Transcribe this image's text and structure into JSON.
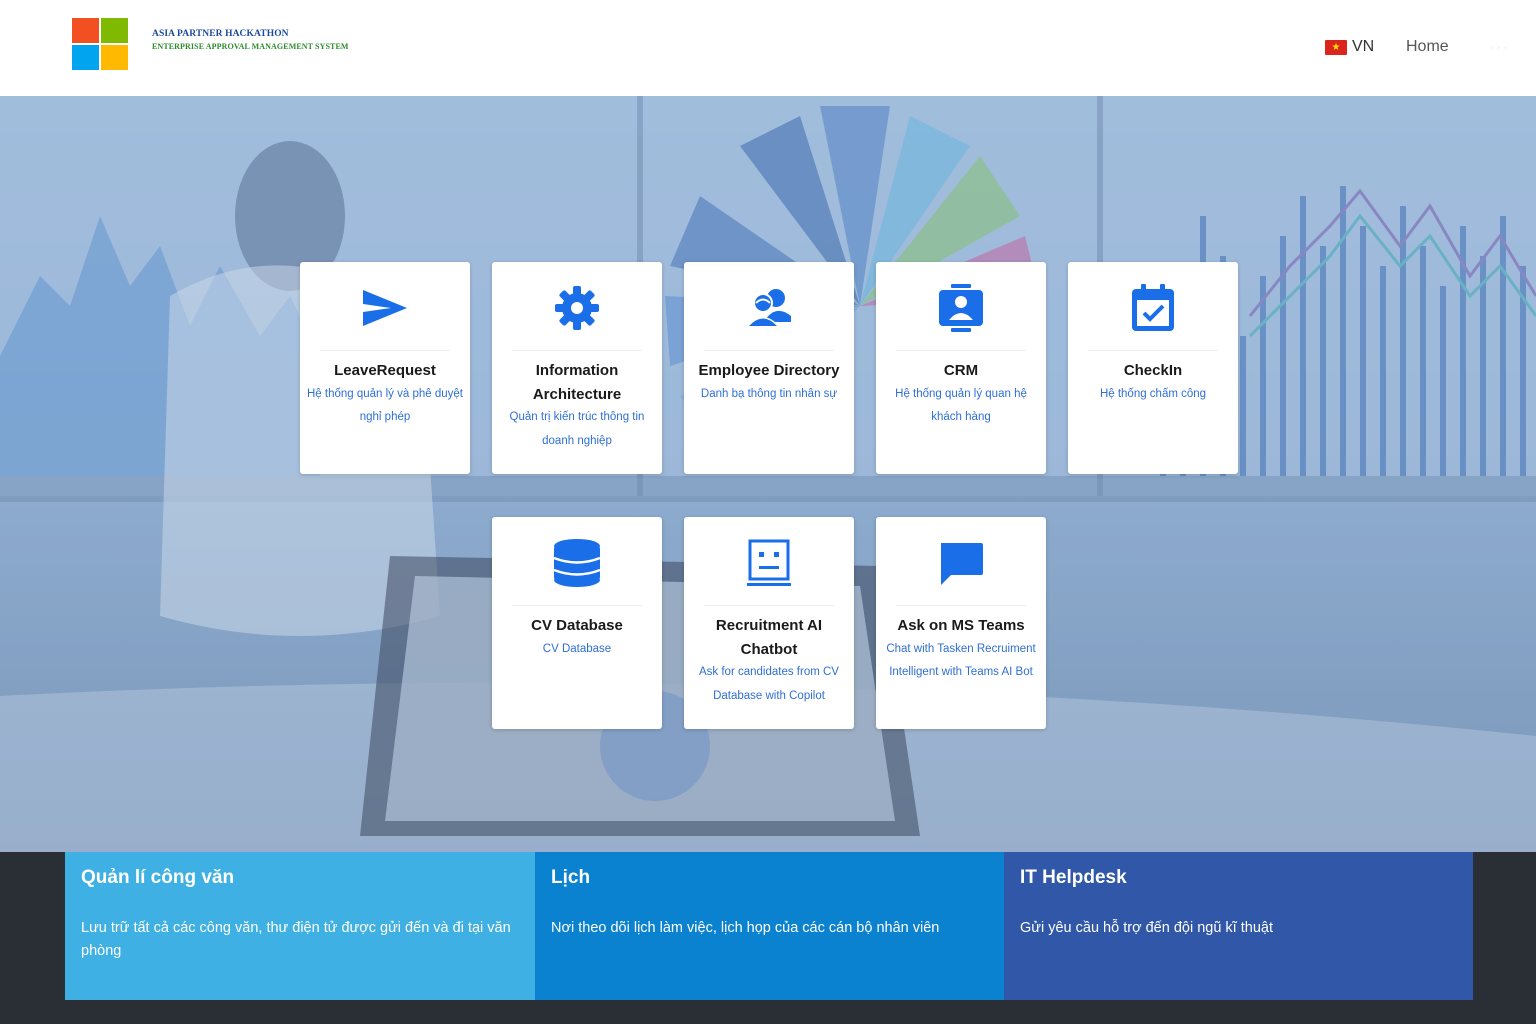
{
  "header": {
    "brand_line1": "ASIA PARTNER HACKATHON",
    "brand_line2": "ENTERPRISE APPROVAL MANAGEMENT SYSTEM",
    "language": "VN",
    "nav_home": "Home"
  },
  "apps": [
    {
      "title": "LeaveRequest",
      "description": "Hệ thống quản lý và phê duyệt nghỉ phép",
      "icon": "paper-plane-icon"
    },
    {
      "title": "Information Architecture",
      "description": "Quản trị kiến trúc thông tin doanh nghiệp",
      "icon": "gear-icon"
    },
    {
      "title": "Employee Directory",
      "description": "Danh bạ thông tin nhân sự",
      "icon": "people-icon"
    },
    {
      "title": "CRM",
      "description": "Hệ thống quản lý quan hệ khách hàng",
      "icon": "contact-badge-icon"
    },
    {
      "title": "CheckIn",
      "description": "Hệ thống chấm công",
      "icon": "calendar-check-icon"
    },
    {
      "title": "CV Database",
      "description": "CV Database",
      "icon": "database-icon"
    },
    {
      "title": "Recruitment AI Chatbot",
      "description": "Ask for candidates from CV Database with Copilot",
      "icon": "robot-icon"
    },
    {
      "title": "Ask on MS Teams",
      "description": "Chat with Tasken Recruiment Intelligent with Teams AI Bot",
      "icon": "chat-bubble-icon"
    }
  ],
  "panels": [
    {
      "title": "Quản lí công văn",
      "description": "Lưu trữ tất cả các công văn, thư điện tử được gửi đến và đi tại văn phòng",
      "color": "#3fb0e4"
    },
    {
      "title": "Lịch",
      "description": "Nơi theo dõi lịch làm việc, lịch họp của các cán bộ nhân viên",
      "color": "#0a82d0"
    },
    {
      "title": "IT Helpdesk",
      "description": "Gửi yêu cầu hỗ trợ đến đội ngũ kĩ thuật",
      "color": "#3057a8"
    }
  ],
  "colors": {
    "accent": "#1a73e8",
    "icon": "#1a6fe8"
  }
}
